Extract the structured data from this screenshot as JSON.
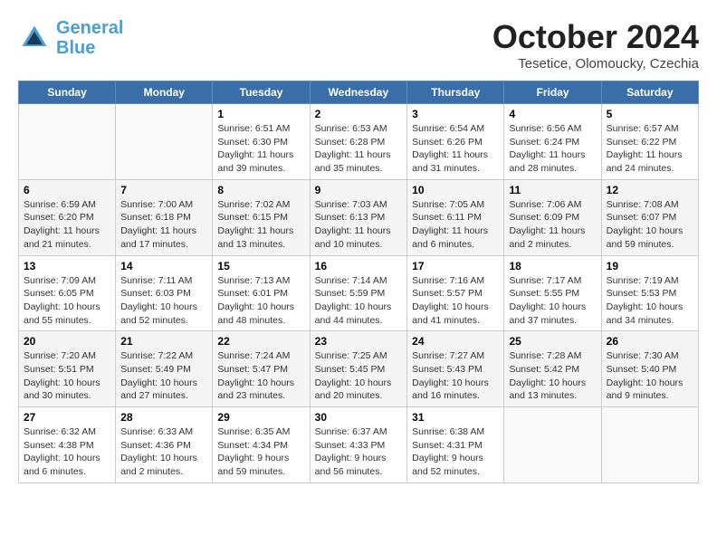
{
  "header": {
    "logo_line1": "General",
    "logo_line2": "Blue",
    "month": "October 2024",
    "location": "Tesetice, Olomoucky, Czechia"
  },
  "days_of_week": [
    "Sunday",
    "Monday",
    "Tuesday",
    "Wednesday",
    "Thursday",
    "Friday",
    "Saturday"
  ],
  "weeks": [
    [
      {
        "day": "",
        "info": ""
      },
      {
        "day": "",
        "info": ""
      },
      {
        "day": "1",
        "info": "Sunrise: 6:51 AM\nSunset: 6:30 PM\nDaylight: 11 hours and 39 minutes."
      },
      {
        "day": "2",
        "info": "Sunrise: 6:53 AM\nSunset: 6:28 PM\nDaylight: 11 hours and 35 minutes."
      },
      {
        "day": "3",
        "info": "Sunrise: 6:54 AM\nSunset: 6:26 PM\nDaylight: 11 hours and 31 minutes."
      },
      {
        "day": "4",
        "info": "Sunrise: 6:56 AM\nSunset: 6:24 PM\nDaylight: 11 hours and 28 minutes."
      },
      {
        "day": "5",
        "info": "Sunrise: 6:57 AM\nSunset: 6:22 PM\nDaylight: 11 hours and 24 minutes."
      }
    ],
    [
      {
        "day": "6",
        "info": "Sunrise: 6:59 AM\nSunset: 6:20 PM\nDaylight: 11 hours and 21 minutes."
      },
      {
        "day": "7",
        "info": "Sunrise: 7:00 AM\nSunset: 6:18 PM\nDaylight: 11 hours and 17 minutes."
      },
      {
        "day": "8",
        "info": "Sunrise: 7:02 AM\nSunset: 6:15 PM\nDaylight: 11 hours and 13 minutes."
      },
      {
        "day": "9",
        "info": "Sunrise: 7:03 AM\nSunset: 6:13 PM\nDaylight: 11 hours and 10 minutes."
      },
      {
        "day": "10",
        "info": "Sunrise: 7:05 AM\nSunset: 6:11 PM\nDaylight: 11 hours and 6 minutes."
      },
      {
        "day": "11",
        "info": "Sunrise: 7:06 AM\nSunset: 6:09 PM\nDaylight: 11 hours and 2 minutes."
      },
      {
        "day": "12",
        "info": "Sunrise: 7:08 AM\nSunset: 6:07 PM\nDaylight: 10 hours and 59 minutes."
      }
    ],
    [
      {
        "day": "13",
        "info": "Sunrise: 7:09 AM\nSunset: 6:05 PM\nDaylight: 10 hours and 55 minutes."
      },
      {
        "day": "14",
        "info": "Sunrise: 7:11 AM\nSunset: 6:03 PM\nDaylight: 10 hours and 52 minutes."
      },
      {
        "day": "15",
        "info": "Sunrise: 7:13 AM\nSunset: 6:01 PM\nDaylight: 10 hours and 48 minutes."
      },
      {
        "day": "16",
        "info": "Sunrise: 7:14 AM\nSunset: 5:59 PM\nDaylight: 10 hours and 44 minutes."
      },
      {
        "day": "17",
        "info": "Sunrise: 7:16 AM\nSunset: 5:57 PM\nDaylight: 10 hours and 41 minutes."
      },
      {
        "day": "18",
        "info": "Sunrise: 7:17 AM\nSunset: 5:55 PM\nDaylight: 10 hours and 37 minutes."
      },
      {
        "day": "19",
        "info": "Sunrise: 7:19 AM\nSunset: 5:53 PM\nDaylight: 10 hours and 34 minutes."
      }
    ],
    [
      {
        "day": "20",
        "info": "Sunrise: 7:20 AM\nSunset: 5:51 PM\nDaylight: 10 hours and 30 minutes."
      },
      {
        "day": "21",
        "info": "Sunrise: 7:22 AM\nSunset: 5:49 PM\nDaylight: 10 hours and 27 minutes."
      },
      {
        "day": "22",
        "info": "Sunrise: 7:24 AM\nSunset: 5:47 PM\nDaylight: 10 hours and 23 minutes."
      },
      {
        "day": "23",
        "info": "Sunrise: 7:25 AM\nSunset: 5:45 PM\nDaylight: 10 hours and 20 minutes."
      },
      {
        "day": "24",
        "info": "Sunrise: 7:27 AM\nSunset: 5:43 PM\nDaylight: 10 hours and 16 minutes."
      },
      {
        "day": "25",
        "info": "Sunrise: 7:28 AM\nSunset: 5:42 PM\nDaylight: 10 hours and 13 minutes."
      },
      {
        "day": "26",
        "info": "Sunrise: 7:30 AM\nSunset: 5:40 PM\nDaylight: 10 hours and 9 minutes."
      }
    ],
    [
      {
        "day": "27",
        "info": "Sunrise: 6:32 AM\nSunset: 4:38 PM\nDaylight: 10 hours and 6 minutes."
      },
      {
        "day": "28",
        "info": "Sunrise: 6:33 AM\nSunset: 4:36 PM\nDaylight: 10 hours and 2 minutes."
      },
      {
        "day": "29",
        "info": "Sunrise: 6:35 AM\nSunset: 4:34 PM\nDaylight: 9 hours and 59 minutes."
      },
      {
        "day": "30",
        "info": "Sunrise: 6:37 AM\nSunset: 4:33 PM\nDaylight: 9 hours and 56 minutes."
      },
      {
        "day": "31",
        "info": "Sunrise: 6:38 AM\nSunset: 4:31 PM\nDaylight: 9 hours and 52 minutes."
      },
      {
        "day": "",
        "info": ""
      },
      {
        "day": "",
        "info": ""
      }
    ]
  ]
}
